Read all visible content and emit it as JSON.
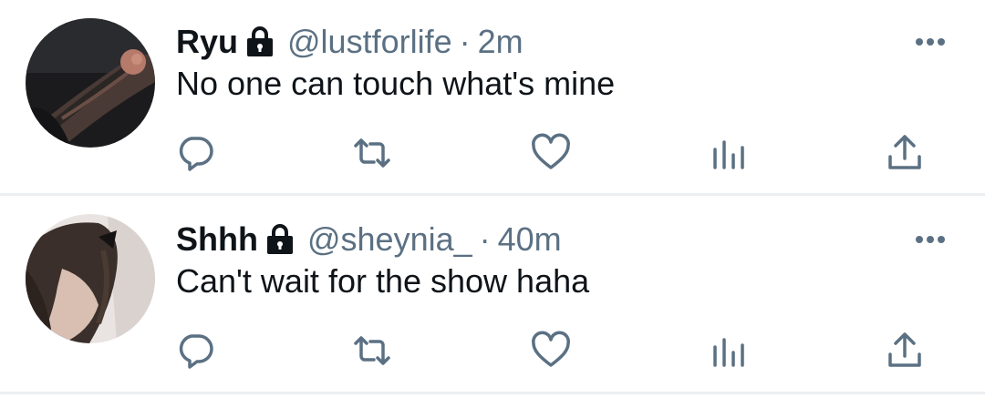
{
  "tweets": [
    {
      "name": "Ryu",
      "handle": "@lustforlife",
      "separator": "·",
      "time": "2m",
      "text": "No one can touch what's mine",
      "avatar_desc_icon": "tattooed-arm-avatar",
      "locked": true
    },
    {
      "name": "Shhh",
      "handle": "@sheynia_",
      "separator": "·",
      "time": "40m",
      "text": "Can't wait for the show haha",
      "avatar_desc_icon": "girl-hair-avatar",
      "locked": true
    }
  ],
  "icons": {
    "lock": "lock-icon",
    "more": "more-dots-icon",
    "reply": "reply-icon",
    "retweet": "retweet-icon",
    "like": "heart-icon",
    "analytics": "analytics-icon",
    "share": "share-icon"
  },
  "colors": {
    "text": "#0f1419",
    "secondary": "#5b7083",
    "icon": "#5b7083",
    "divider": "#eceff1"
  }
}
